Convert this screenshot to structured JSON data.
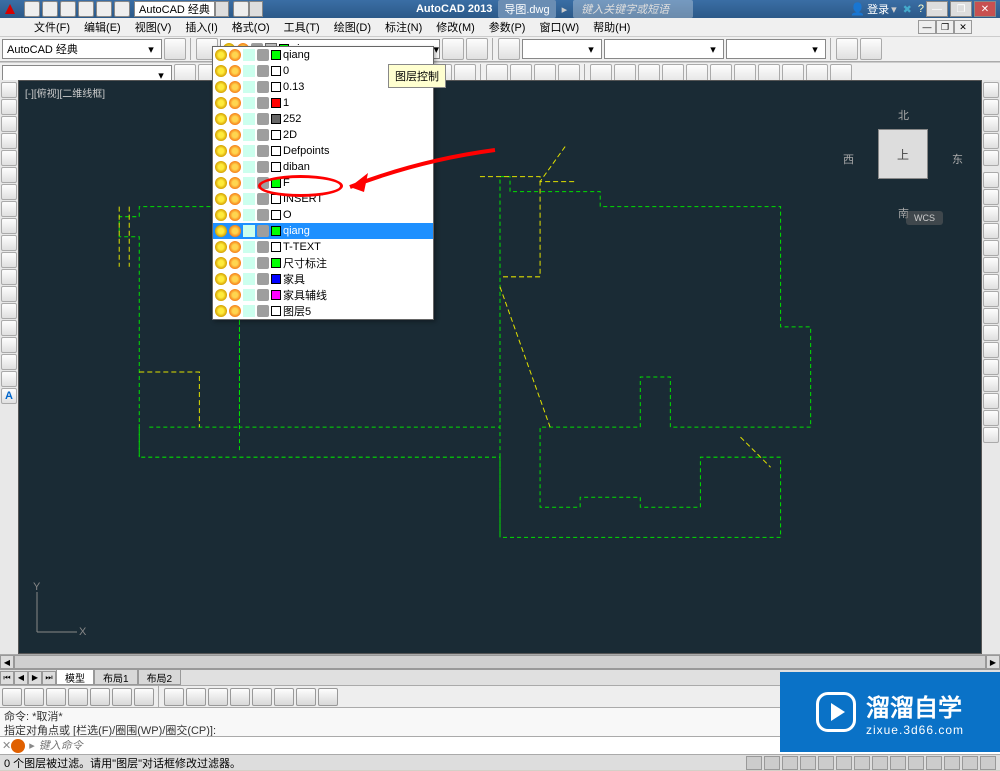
{
  "title": {
    "app_name": "AutoCAD 2013",
    "doc_name": "导图.dwg",
    "search_placeholder": "键入关键字或短语",
    "login": "登录",
    "workspace": "AutoCAD 经典"
  },
  "menu": {
    "items": [
      "文件(F)",
      "编辑(E)",
      "视图(V)",
      "插入(I)",
      "格式(O)",
      "工具(T)",
      "绘图(D)",
      "标注(N)",
      "修改(M)",
      "参数(P)",
      "窗口(W)",
      "帮助(H)"
    ]
  },
  "toolbar2": {
    "workspace_combo": "AutoCAD 经典",
    "current_layer": "qiang"
  },
  "layer_dropdown": {
    "hint": "图层控制",
    "items": [
      {
        "name": "qiang",
        "color": "#00ff00",
        "highlight": false
      },
      {
        "name": "0",
        "color": "#ffffff",
        "highlight": false
      },
      {
        "name": "0.13",
        "color": "#ffffff",
        "highlight": false
      },
      {
        "name": "1",
        "color": "#ff0000",
        "highlight": false
      },
      {
        "name": "252",
        "color": "#666666",
        "highlight": false
      },
      {
        "name": "2D",
        "color": "#ffffff",
        "highlight": false
      },
      {
        "name": "Defpoints",
        "color": "#ffffff",
        "highlight": false
      },
      {
        "name": "diban",
        "color": "#ffffff",
        "highlight": false
      },
      {
        "name": "F",
        "color": "#00ff00",
        "highlight": false
      },
      {
        "name": "INSERT",
        "color": "#ffffff",
        "highlight": false
      },
      {
        "name": "O",
        "color": "#ffffff",
        "highlight": false
      },
      {
        "name": "qiang",
        "color": "#00ff00",
        "highlight": true
      },
      {
        "name": "T-TEXT",
        "color": "#ffffff",
        "highlight": false
      },
      {
        "name": "尺寸标注",
        "color": "#00ff00",
        "highlight": false
      },
      {
        "name": "家具",
        "color": "#0000ff",
        "highlight": false
      },
      {
        "name": "家具辅线",
        "color": "#ff00ff",
        "highlight": false
      },
      {
        "name": "图层5",
        "color": "#ffffff",
        "highlight": false
      }
    ]
  },
  "viewport": {
    "label": "[-][俯视][二维线框]",
    "cube_top": "上",
    "dirs": {
      "n": "北",
      "s": "南",
      "e": "东",
      "w": "西"
    },
    "wcs": "WCS",
    "ucs_y": "Y",
    "ucs_x": "X"
  },
  "tabs": {
    "items": [
      "模型",
      "布局1",
      "布局2"
    ]
  },
  "command": {
    "line1": "命令: *取消*",
    "line2": "指定对角点或 [栏选(F)/圈围(WP)/圈交(CP)]:",
    "placeholder": "键入命令"
  },
  "status": {
    "msg": "0 个图层被过滤。请用\"图层\"对话框修改过滤器。"
  },
  "watermark": {
    "big": "溜溜自学",
    "small": "zixue.3d66.com"
  }
}
